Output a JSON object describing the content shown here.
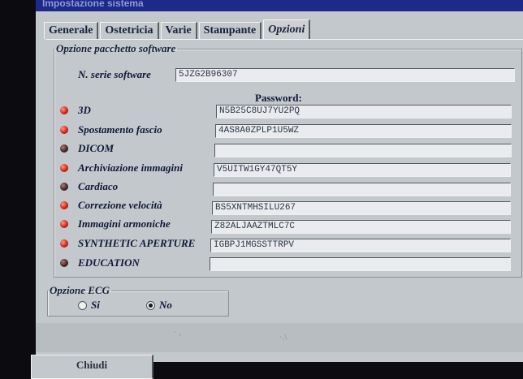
{
  "window": {
    "title": "Impostazione sistema"
  },
  "tabs": [
    {
      "label": "Generale",
      "active": false
    },
    {
      "label": "Ostetricia",
      "active": false
    },
    {
      "label": "Varie",
      "active": false
    },
    {
      "label": "Stampante",
      "active": false
    },
    {
      "label": "Opzioni",
      "active": true
    }
  ],
  "software_options": {
    "group_label": "Opzione pacchetto software",
    "serial_label": "N. serie software",
    "serial_value": "5JZG2B96307",
    "password_header": "Password:",
    "rows": [
      {
        "label": "3D",
        "password": "N5B25C8UJ7YU2PQ",
        "status": "on"
      },
      {
        "label": "Spostamento fascio",
        "password": "4AS8A0ZPLP1U5WZ",
        "status": "on"
      },
      {
        "label": "DICOM",
        "password": "",
        "status": "off"
      },
      {
        "label": "Archiviazione immagini",
        "password": "V5UITW1GY47QT5Y",
        "status": "on"
      },
      {
        "label": "Cardiaco",
        "password": "",
        "status": "off"
      },
      {
        "label": "Correzione velocità",
        "password": "BS5XNTMHSILU267",
        "status": "on"
      },
      {
        "label": "Immagini armoniche",
        "password": "Z82ALJAAZTMLC7C",
        "status": "on"
      },
      {
        "label": "SYNTHETIC APERTURE",
        "password": "IGBPJ1MGSSTTRPV",
        "status": "on"
      },
      {
        "label": "EDUCATION",
        "password": "",
        "status": "off"
      }
    ]
  },
  "ecg_option": {
    "group_label": "Opzione ECG",
    "options": [
      {
        "label": "Si",
        "checked": false
      },
      {
        "label": "No",
        "checked": true
      }
    ]
  },
  "footer": {
    "close_label": "Chiudi"
  },
  "colors": {
    "led_on": "#d42414",
    "led_off": "#4c2622",
    "title_bar": "#1d2a8a",
    "panel": "#c3c8cc"
  }
}
